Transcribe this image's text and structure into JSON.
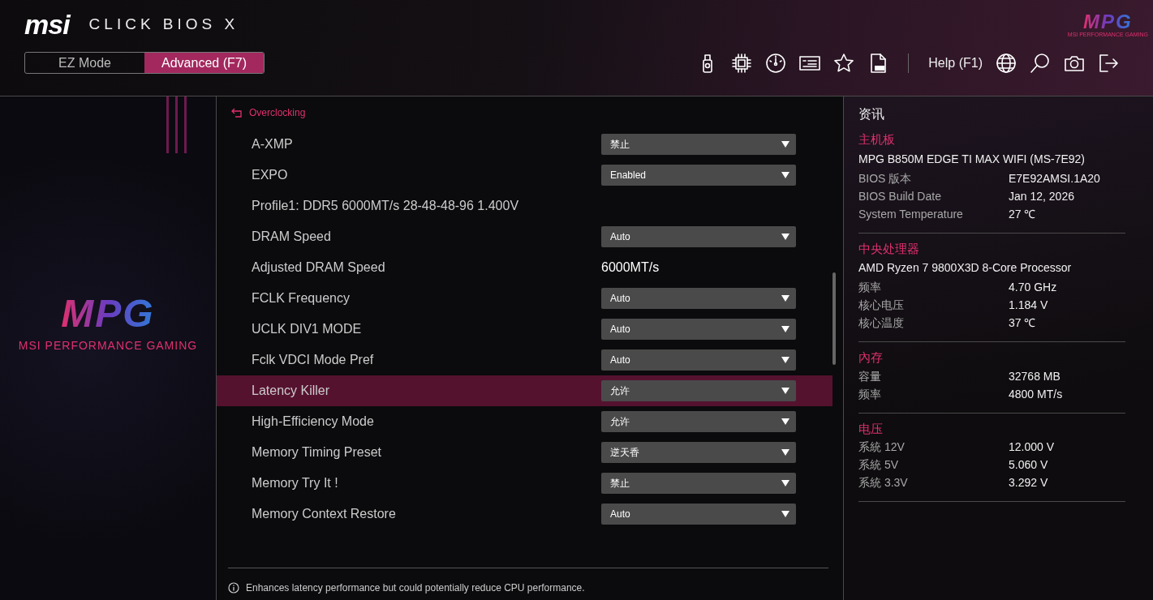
{
  "header": {
    "logo": "msi",
    "product": "CLICK BIOS X",
    "brand_mark": "MPG",
    "brand_tagline": "MSI PERFORMANCE GAMING"
  },
  "modes": [
    {
      "label": "EZ Mode",
      "selected": false
    },
    {
      "label": "Advanced (F7)",
      "selected": true
    }
  ],
  "toolbar": {
    "help": "Help (F1)"
  },
  "sidebar": {
    "brand_mark": "MPG",
    "brand_tagline": "MSI PERFORMANCE GAMING"
  },
  "breadcrumb": "Overclocking",
  "settings": [
    {
      "kind": "select",
      "label": "A-XMP",
      "value": "禁止",
      "selected": false
    },
    {
      "kind": "select",
      "label": "EXPO",
      "value": "Enabled",
      "selected": false
    },
    {
      "kind": "info",
      "label": "Profile1: DDR5 6000MT/s 28-48-48-96 1.400V",
      "selected": false
    },
    {
      "kind": "select",
      "label": "DRAM Speed",
      "value": "Auto",
      "selected": false
    },
    {
      "kind": "readout",
      "label": "Adjusted DRAM Speed",
      "value": "6000MT/s",
      "selected": false
    },
    {
      "kind": "select",
      "label": "FCLK Frequency",
      "value": "Auto",
      "selected": false
    },
    {
      "kind": "select",
      "label": "UCLK DIV1 MODE",
      "value": "Auto",
      "selected": false
    },
    {
      "kind": "select",
      "label": "Fclk VDCI Mode Pref",
      "value": "Auto",
      "selected": false
    },
    {
      "kind": "select",
      "label": "Latency Killer",
      "value": "允许",
      "selected": true
    },
    {
      "kind": "select",
      "label": "High-Efficiency Mode",
      "value": "允许",
      "selected": false
    },
    {
      "kind": "select",
      "label": "Memory Timing Preset",
      "value": "逆天香",
      "selected": false
    },
    {
      "kind": "select",
      "label": "Memory Try It !",
      "value": "禁止",
      "selected": false
    },
    {
      "kind": "select",
      "label": "Memory Context Restore",
      "value": "Auto",
      "selected": false
    }
  ],
  "help_text": "Enhances latency performance but could potentially reduce CPU performance.",
  "info": {
    "title": "资讯",
    "sections": [
      {
        "heading": "主机板",
        "subtitle": "MPG B850M EDGE TI MAX WIFI (MS-7E92)",
        "rows": [
          {
            "label": "BIOS 版本",
            "value": "E7E92AMSI.1A20"
          },
          {
            "label": "BIOS Build Date",
            "value": "Jan 12, 2026"
          },
          {
            "label": "System Temperature",
            "value": "27 ℃"
          }
        ]
      },
      {
        "heading": "中央处理器",
        "subtitle": "AMD Ryzen 7 9800X3D 8-Core Processor",
        "rows": [
          {
            "label": "频率",
            "value": "4.70 GHz"
          },
          {
            "label": "核心电压",
            "value": "1.184 V"
          },
          {
            "label": "核心温度",
            "value": "37 ℃"
          }
        ]
      },
      {
        "heading": "內存",
        "rows": [
          {
            "label": "容量",
            "value": "32768 MB"
          },
          {
            "label": "频率",
            "value": "4800 MT/s"
          }
        ]
      },
      {
        "heading": "电压",
        "rows": [
          {
            "label": "系統 12V",
            "value": "12.000 V"
          },
          {
            "label": "系統 5V",
            "value": "5.060 V"
          },
          {
            "label": "系統 3.3V",
            "value": "3.292 V"
          }
        ]
      }
    ]
  }
}
